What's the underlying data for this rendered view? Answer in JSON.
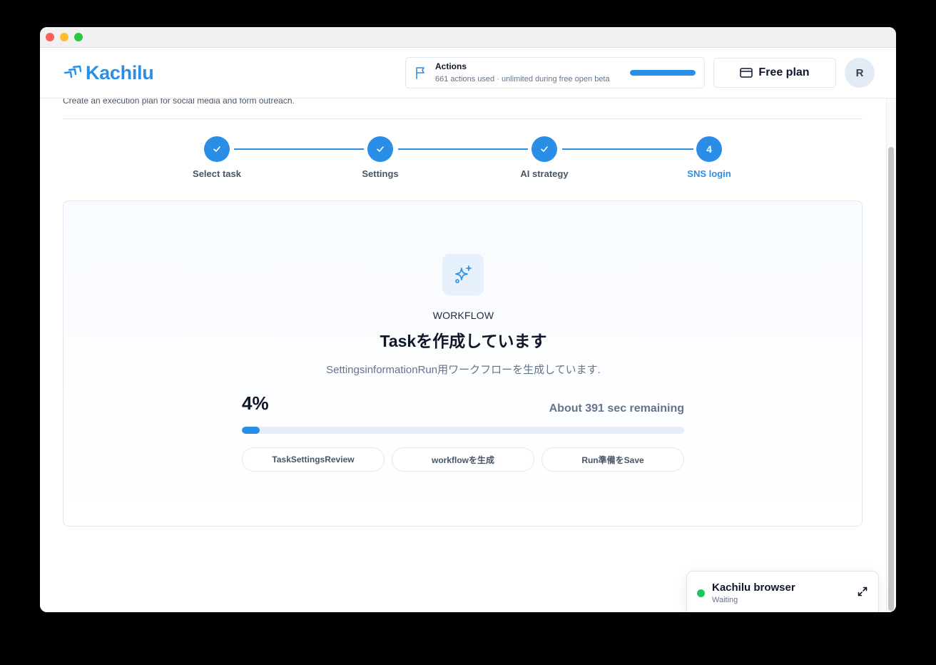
{
  "app": {
    "name": "Kachilu"
  },
  "header": {
    "actions": {
      "title": "Actions",
      "subtitle": "661 actions used · unlimited during free open beta",
      "usage_fraction": 1.0,
      "icon": "flag-icon"
    },
    "plan_button": {
      "label": "Free plan",
      "icon": "credit-card-icon"
    },
    "avatar": {
      "initial": "R"
    }
  },
  "page": {
    "subtitle": "Create an execution plan for social media and form outreach."
  },
  "stepper": {
    "steps": [
      {
        "label": "Select task",
        "state": "done",
        "icon": "check-icon"
      },
      {
        "label": "Settings",
        "state": "done",
        "icon": "check-icon"
      },
      {
        "label": "AI strategy",
        "state": "done",
        "icon": "check-icon"
      },
      {
        "label": "SNS login",
        "state": "active",
        "number": "4"
      }
    ]
  },
  "workflow_card": {
    "icon": "sparkles-icon",
    "eyebrow": "WORKFLOW",
    "title": "Taskを作成しています",
    "description": "SettingsinformationRun用ワークフローを生成しています.",
    "percent_label": "4%",
    "progress_fraction": 0.04,
    "remaining": "About 391 sec remaining",
    "stages": [
      "TaskSettingsReview",
      "workflowを生成",
      "Run準備をSave"
    ]
  },
  "browser_widget": {
    "title": "Kachilu browser",
    "status": "Waiting",
    "status_color": "#22c55e",
    "icon": "expand-icon"
  },
  "colors": {
    "accent": "#2b8ee6",
    "text": "#0f172a",
    "muted": "#64748b"
  }
}
